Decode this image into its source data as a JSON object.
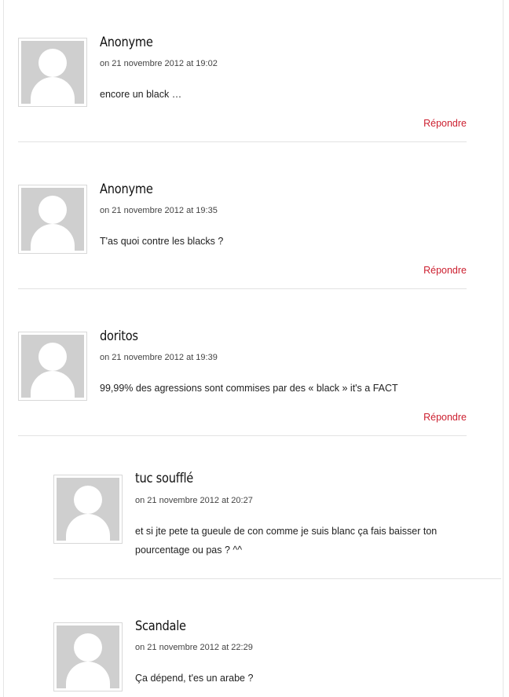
{
  "comments": [
    {
      "author": "Anonyme",
      "date": "on 21 novembre 2012 at 19:02",
      "text": "encore un black …",
      "reply": "Répondre"
    },
    {
      "author": "Anonyme",
      "date": "on 21 novembre 2012 at 19:35",
      "text": "T'as quoi contre les blacks ?",
      "reply": "Répondre"
    },
    {
      "author": "doritos",
      "date": "on 21 novembre 2012 at 19:39",
      "text": "99,99% des agressions sont commises par des « black » it's a FACT",
      "reply": "Répondre"
    },
    {
      "author": "tuc soufflé",
      "date": "on 21 novembre 2012 at 20:27",
      "text": "et si jte pete ta gueule de con comme je suis blanc ça fais baisser ton pourcentage ou pas ? ^^"
    },
    {
      "author": "Scandale",
      "date": "on 21 novembre 2012 at 22:29",
      "text": "Ça dépend, t'es un arabe ?"
    }
  ]
}
